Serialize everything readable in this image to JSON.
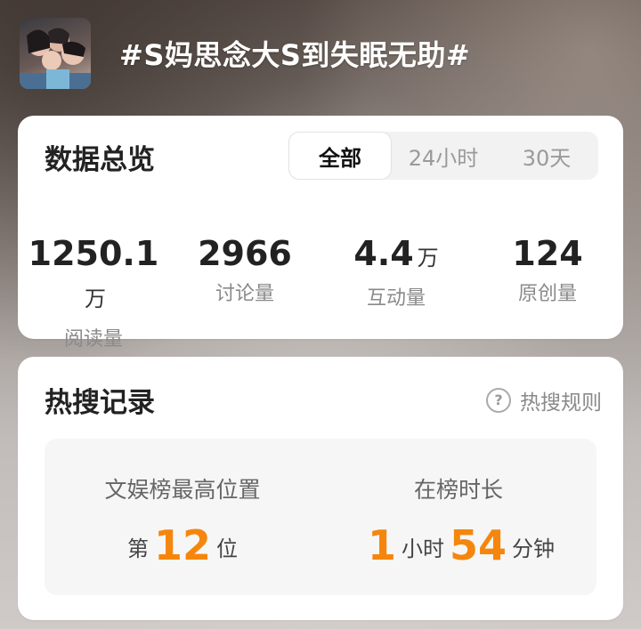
{
  "header": {
    "title": "#S妈思念大S到失眠无助#",
    "avatar_alt": "topic-avatar"
  },
  "overview": {
    "title": "数据总览",
    "tabs": [
      "全部",
      "24小时",
      "30天"
    ],
    "active_tab": "全部",
    "stats": [
      {
        "value": "1250.1",
        "unit": "万",
        "label": "阅读量"
      },
      {
        "value": "2966",
        "unit": "",
        "label": "讨论量"
      },
      {
        "value": "4.4",
        "unit": "万",
        "label": "互动量"
      },
      {
        "value": "124",
        "unit": "",
        "label": "原创量"
      }
    ]
  },
  "hot": {
    "title": "热搜记录",
    "rules_label": "热搜规则",
    "rank": {
      "heading": "文娱榜最高位置",
      "prefix": "第",
      "value": "12",
      "suffix": "位"
    },
    "duration": {
      "heading": "在榜时长",
      "hours": "1",
      "hours_unit": "小时",
      "minutes": "54",
      "minutes_unit": "分钟"
    }
  },
  "colors": {
    "accent": "#f5860d"
  }
}
